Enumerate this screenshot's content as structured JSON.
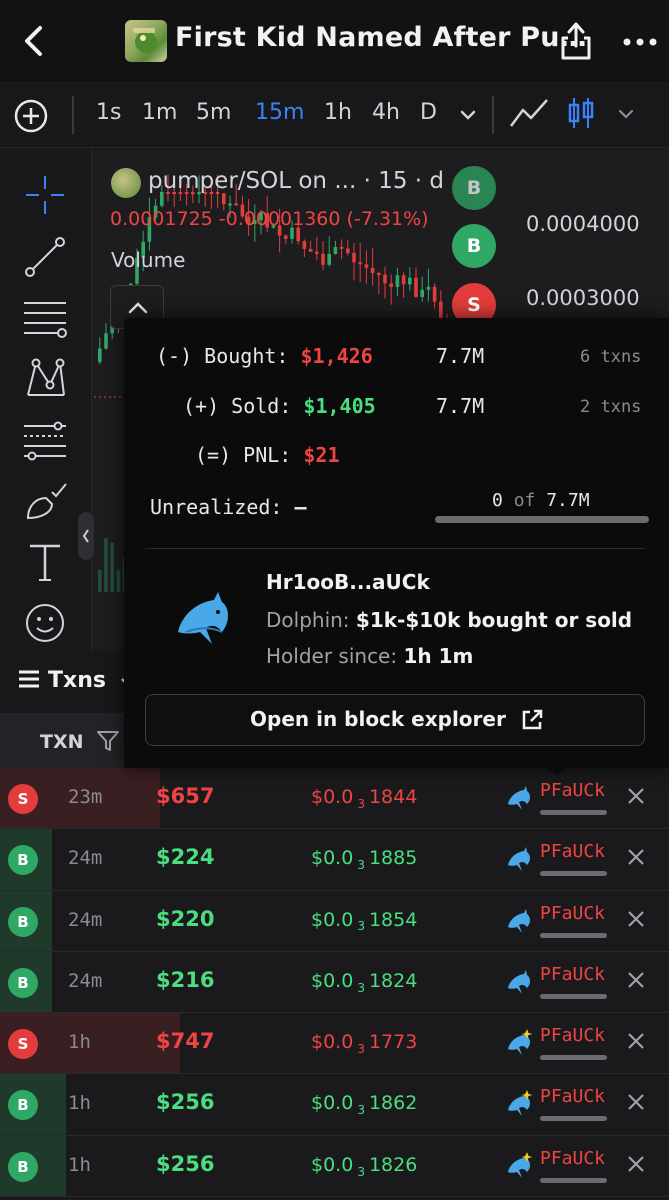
{
  "header": {
    "title": "First Kid Named After Pu…"
  },
  "timeframes": [
    "1s",
    "1m",
    "5m",
    "15m",
    "1h",
    "4h",
    "D"
  ],
  "active_timeframe": "15m",
  "chart": {
    "pair_label": "pumper/SOL on ...",
    "interval_label": "· 15 · d",
    "ohlc": {
      "price": "0.0001725",
      "change": "-0.00001360",
      "change_pct": "(-7.31%)"
    },
    "volume_label": "Volume",
    "axis_labels": [
      "0.0004000",
      "0.0003000"
    ],
    "markers": [
      "B",
      "B",
      "S"
    ],
    "colors": {
      "up": "#2fa866",
      "down": "#e23c3c"
    }
  },
  "txns_tab": {
    "label": "Txns"
  },
  "table": {
    "header_txn": "TXN",
    "rows": [
      {
        "side": "S",
        "age": "23m",
        "usd": "$657",
        "price_a": "$0.0",
        "price_sub": "3",
        "price_b": "1844",
        "maker": "PFaUCk",
        "maker_icon": "dolphin-icon"
      },
      {
        "side": "B",
        "age": "24m",
        "usd": "$224",
        "price_a": "$0.0",
        "price_sub": "3",
        "price_b": "1885",
        "maker": "PFaUCk",
        "maker_icon": "dolphin-icon"
      },
      {
        "side": "B",
        "age": "24m",
        "usd": "$220",
        "price_a": "$0.0",
        "price_sub": "3",
        "price_b": "1854",
        "maker": "PFaUCk",
        "maker_icon": "dolphin-icon"
      },
      {
        "side": "B",
        "age": "24m",
        "usd": "$216",
        "price_a": "$0.0",
        "price_sub": "3",
        "price_b": "1824",
        "maker": "PFaUCk",
        "maker_icon": "dolphin-icon"
      },
      {
        "side": "S",
        "age": "1h",
        "usd": "$747",
        "price_a": "$0.0",
        "price_sub": "3",
        "price_b": "1773",
        "maker": "PFaUCk",
        "maker_icon": "sparkle-dolphin-icon"
      },
      {
        "side": "B",
        "age": "1h",
        "usd": "$256",
        "price_a": "$0.0",
        "price_sub": "3",
        "price_b": "1862",
        "maker": "PFaUCk",
        "maker_icon": "sparkle-dolphin-icon"
      },
      {
        "side": "B",
        "age": "1h",
        "usd": "$256",
        "price_a": "$0.0",
        "price_sub": "3",
        "price_b": "1826",
        "maker": "PFaUCk",
        "maker_icon": "sparkle-dolphin-icon"
      }
    ]
  },
  "popover": {
    "bought_label": "(-) Bought:",
    "bought_usd": "$1,426",
    "bought_amount": "7.7M",
    "bought_txns": "6 txns",
    "sold_label": "(+) Sold:",
    "sold_usd": "$1,405",
    "sold_amount": "7.7M",
    "sold_txns": "2 txns",
    "pnl_label": "(=) PNL:",
    "pnl_usd": "$21",
    "unrealized_label": "Unrealized:",
    "unrealized_value": "–",
    "holding_current": "0",
    "holding_of": "of",
    "holding_total": "7.7M",
    "wallet": "Hr1ooB...aUCk",
    "tier_label": "Dolphin:",
    "tier_value": "$1k-$10k bought or sold",
    "since_label": "Holder since:",
    "since_value": "1h 1m",
    "explorer_label": "Open in block explorer"
  }
}
